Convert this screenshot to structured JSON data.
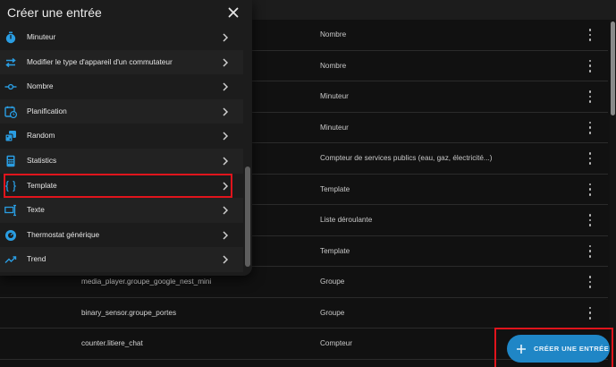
{
  "dialog": {
    "title": "Créer une entrée",
    "items": [
      {
        "label": "Minuteur",
        "icon": "timer-icon"
      },
      {
        "label": "Modifier le type d'appareil d'un commutateur",
        "icon": "swap-arrows-icon"
      },
      {
        "label": "Nombre",
        "icon": "ray-vertex-icon"
      },
      {
        "label": "Planification",
        "icon": "calendar-clock-icon"
      },
      {
        "label": "Random",
        "icon": "dice-icon"
      },
      {
        "label": "Statistics",
        "icon": "calculator-icon"
      },
      {
        "label": "Template",
        "icon": "code-braces-icon"
      },
      {
        "label": "Texte",
        "icon": "form-textbox-icon"
      },
      {
        "label": "Thermostat générique",
        "icon": "thermostat-icon"
      },
      {
        "label": "Trend",
        "icon": "trending-up-icon"
      }
    ]
  },
  "table": {
    "rows": [
      {
        "entity": "",
        "type": "Nombre"
      },
      {
        "entity": "",
        "type": "Nombre"
      },
      {
        "entity": "",
        "type": "Minuteur"
      },
      {
        "entity": "",
        "type": "Minuteur"
      },
      {
        "entity": "",
        "type": "Compteur de services publics (eau, gaz, électricité...)"
      },
      {
        "entity": "",
        "type": "Template"
      },
      {
        "entity": "",
        "type": "Liste déroulante"
      },
      {
        "entity": "",
        "type": "Template"
      },
      {
        "entity": "media_player.groupe_google_nest_mini",
        "type": "Groupe"
      },
      {
        "entity": "binary_sensor.groupe_portes",
        "type": "Groupe"
      },
      {
        "entity": "counter.litiere_chat",
        "type": "Compteur"
      }
    ]
  },
  "fab": {
    "label": "CRÉER UNE ENTRÉE",
    "icon": "plus-icon"
  },
  "colors": {
    "accent": "#1f86c6",
    "icon": "#2a9de2",
    "highlight": "#e0141c",
    "surface": "#1c1c1c",
    "background": "#111111"
  }
}
